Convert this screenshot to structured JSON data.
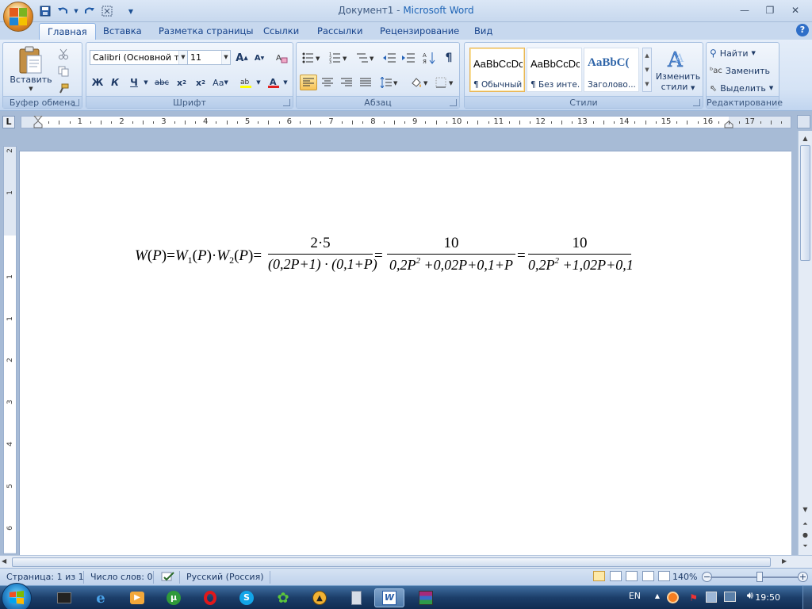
{
  "window": {
    "doc_name": "Документ1",
    "separator": " - ",
    "app_name": "Microsoft Word"
  },
  "tabs": [
    {
      "label": "Главная"
    },
    {
      "label": "Вставка"
    },
    {
      "label": "Разметка страницы"
    },
    {
      "label": "Ссылки"
    },
    {
      "label": "Рассылки"
    },
    {
      "label": "Рецензирование"
    },
    {
      "label": "Вид"
    }
  ],
  "ribbon": {
    "clipboard": {
      "label": "Буфер обмена",
      "paste_label": "Вставить"
    },
    "font": {
      "label": "Шрифт",
      "font_name": "Calibri (Основной те",
      "font_size": "11",
      "bold": "Ж",
      "italic": "К",
      "underline": "Ч",
      "strike": "abc",
      "grow": "A",
      "shrink": "A",
      "case": "Aa"
    },
    "paragraph": {
      "label": "Абзац",
      "pilcrow": "¶"
    },
    "styles": {
      "label": "Стили",
      "items": [
        {
          "sample": "AaBbCcDc",
          "name": "¶ Обычный"
        },
        {
          "sample": "AaBbCcDc",
          "name": "¶ Без инте..."
        },
        {
          "sample": "AaBbC(",
          "name": "Заголово..."
        }
      ],
      "change_label_1": "Изменить",
      "change_label_2": "стили"
    },
    "editing": {
      "label": "Редактирование",
      "find": "Найти",
      "replace": "Заменить",
      "select": "Выделить"
    }
  },
  "ruler": {
    "corner": "L",
    "marks": [
      "1",
      "2",
      "3",
      "4",
      "5",
      "6",
      "7",
      "8",
      "9",
      "10",
      "11",
      "12",
      "13",
      "14",
      "15",
      "16",
      "17"
    ],
    "vmarks_top": [
      "2",
      "1"
    ],
    "vmarks": [
      "1",
      "1",
      "2",
      "3",
      "4",
      "5",
      "6",
      "7"
    ]
  },
  "equation": {
    "lhs_W": "W",
    "lhs_P": "P",
    "w1": "W",
    "w1_sub": "1",
    "w2": "W",
    "w2_sub": "2",
    "f1_num": "2·5",
    "f1_den": "(0,2P+1) · (0,1+P)",
    "f2_num": "10",
    "f2_den_a": "0,2P",
    "f2_den_sup": "2",
    "f2_den_b": " +0,02P+0,1+P",
    "f3_num": "10",
    "f3_den_a": "0,2P",
    "f3_den_sup": "2",
    "f3_den_b": " +1,02P+0,1"
  },
  "status": {
    "page": "Страница: 1 из 1",
    "words": "Число слов: 0",
    "language": "Русский (Россия)",
    "zoom": "140%",
    "zoom_level_percent": 140
  },
  "taskbar": {
    "lang": "EN",
    "time": "19:50"
  }
}
